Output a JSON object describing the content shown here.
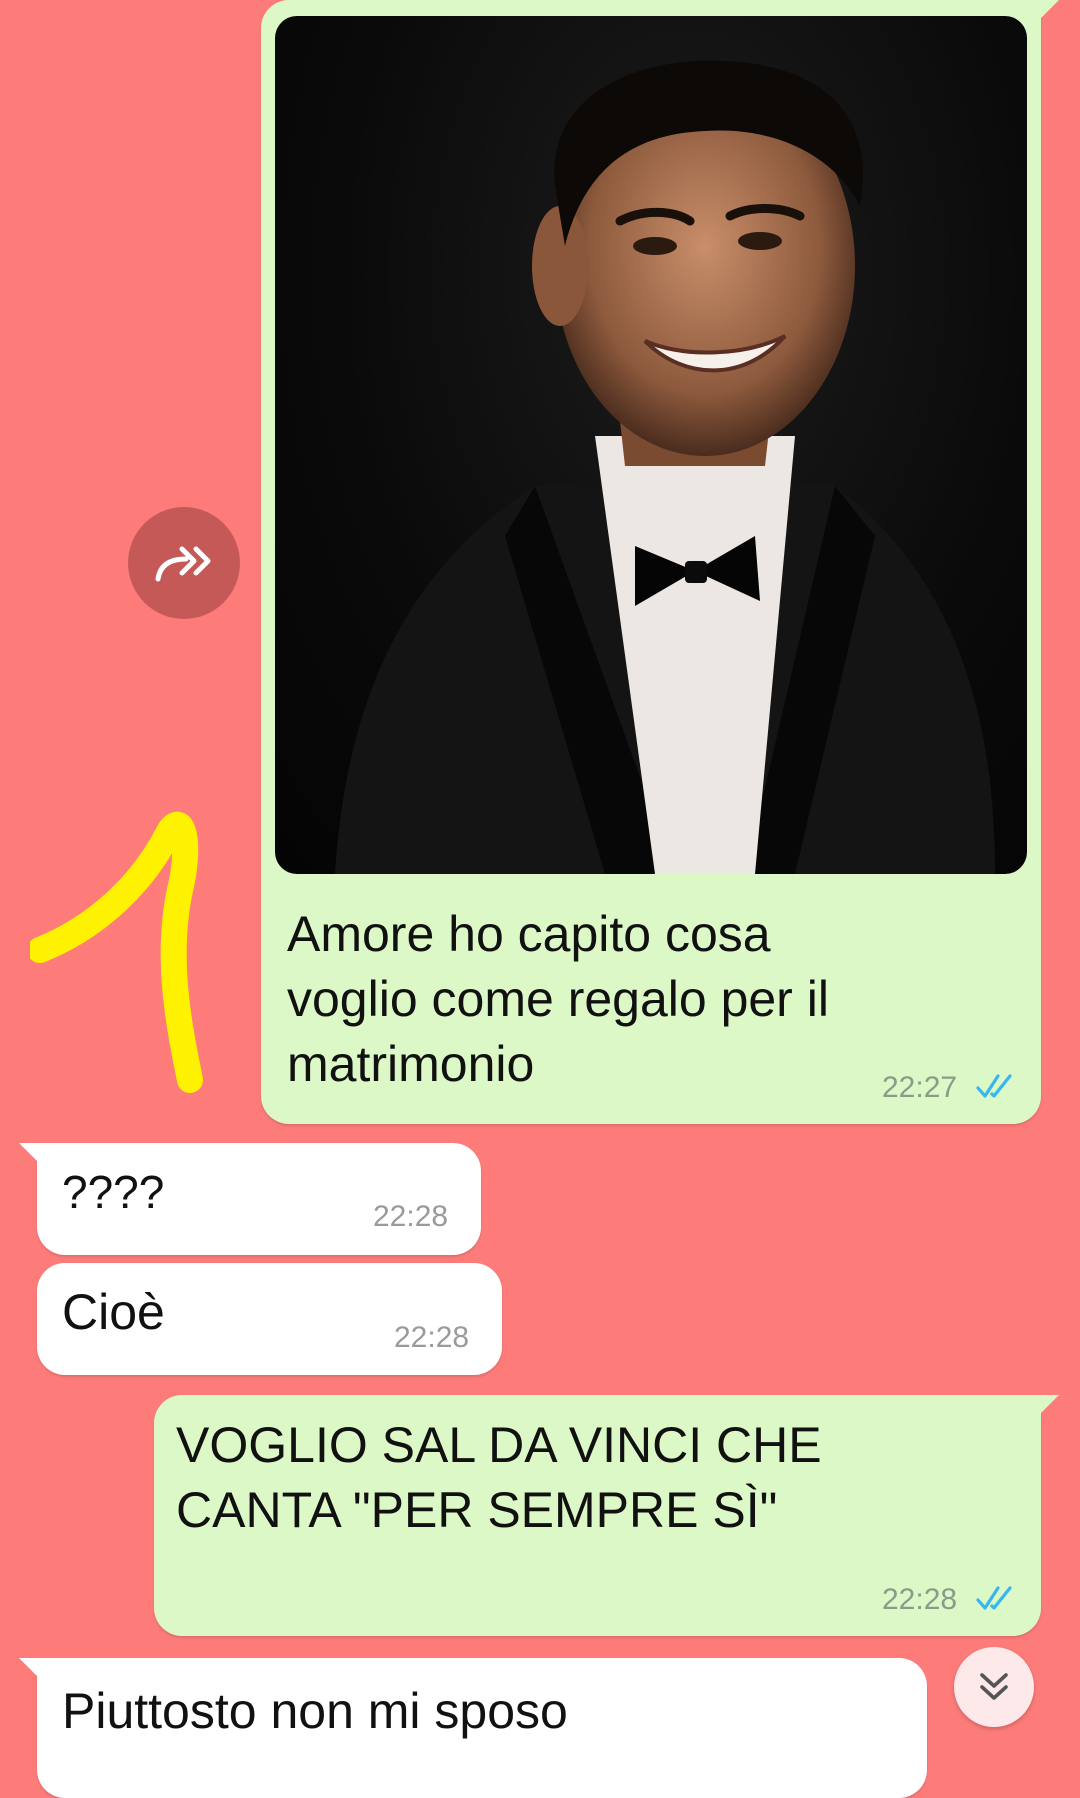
{
  "messages": [
    {
      "id": "m1",
      "direction": "outgoing",
      "has_image": true,
      "image_icon": "portrait-photo",
      "lines": [
        "Amore ho capito cosa",
        "voglio come regalo per il",
        "matrimonio"
      ],
      "time": "22:27",
      "status": "read"
    },
    {
      "id": "m2",
      "direction": "incoming",
      "lines": [
        "????"
      ],
      "time": "22:28"
    },
    {
      "id": "m3",
      "direction": "incoming",
      "lines": [
        "Cioè"
      ],
      "time": "22:28"
    },
    {
      "id": "m4",
      "direction": "outgoing",
      "lines": [
        "VOGLIO SAL DA VINCI CHE",
        "CANTA \"PER SEMPRE SÌ\""
      ],
      "time": "22:28",
      "status": "read"
    },
    {
      "id": "m5",
      "direction": "incoming",
      "lines": [
        "Piuttosto non mi sposo"
      ]
    }
  ],
  "icons": {
    "forward": "forward-icon",
    "scroll_down": "chevron-double-down-icon",
    "read_receipt": "double-check-icon",
    "annotation": "yellow-doodle"
  },
  "colors": {
    "wallpaper": "#fd7c7a",
    "outgoing_bubble": "#dcf8c6",
    "incoming_bubble": "#ffffff",
    "read_tick": "#34b7f1",
    "doodle": "#fff200"
  }
}
